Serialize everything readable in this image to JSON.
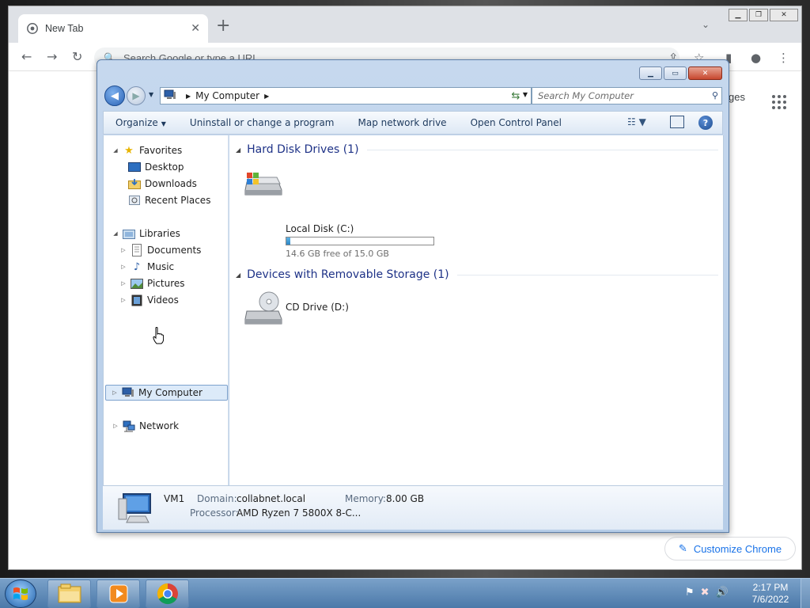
{
  "chrome": {
    "tab_title": "New Tab",
    "omnibox_placeholder": "Search Google or type a URL",
    "images_link": "ges",
    "customize_label": "Customize Chrome"
  },
  "explorer": {
    "address": {
      "location": "My Computer"
    },
    "search_placeholder": "Search My Computer",
    "commands": [
      "Organize",
      "Uninstall or change a program",
      "Map network drive",
      "Open Control Panel"
    ],
    "nav": {
      "favorites": "Favorites",
      "desktop": "Desktop",
      "downloads": "Downloads",
      "recent_places": "Recent Places",
      "libraries": "Libraries",
      "documents": "Documents",
      "music": "Music",
      "pictures": "Pictures",
      "videos": "Videos",
      "my_computer": "My Computer",
      "network": "Network"
    },
    "groups": {
      "hdd_header": "Hard Disk Drives (1)",
      "removable_header": "Devices with Removable Storage (1)"
    },
    "drives": {
      "c_name": "Local Disk (C:)",
      "c_free": "14.6 GB free of 15.0 GB",
      "c_used_percent": 2.7,
      "d_name": "CD Drive (D:)"
    },
    "details": {
      "computer_name": "VM1",
      "domain_label": "Domain:",
      "domain_value": "collabnet.local",
      "memory_label": "Memory:",
      "memory_value": "8.00 GB",
      "processor_label": "Processor:",
      "processor_value": "AMD Ryzen 7 5800X 8-C..."
    }
  },
  "taskbar": {
    "time": "2:17 PM",
    "date": "7/6/2022"
  }
}
